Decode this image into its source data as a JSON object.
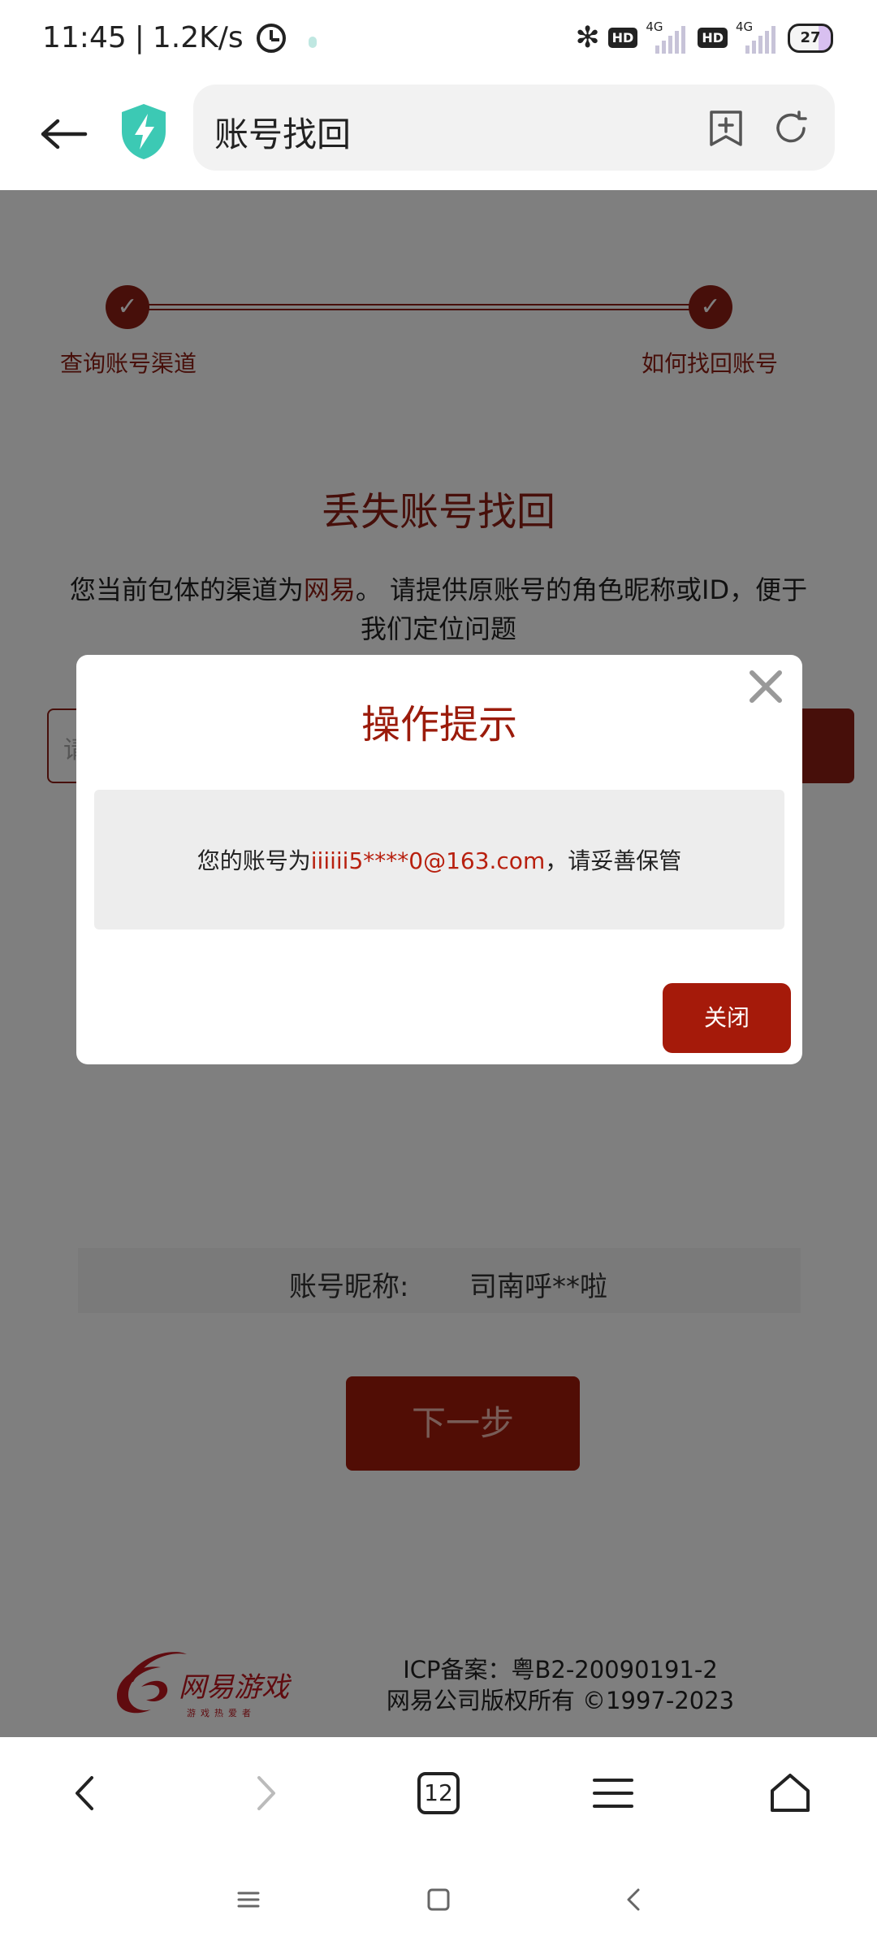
{
  "status_bar": {
    "time": "11:45",
    "separator": "|",
    "speed": "1.2K/s",
    "hd1": "HD",
    "net1": "4G",
    "hd2": "HD",
    "net2": "4G",
    "battery": "27"
  },
  "address_bar": {
    "title": "账号找回"
  },
  "steps": [
    {
      "label": "查询账号渠道",
      "icon": "check-icon"
    },
    {
      "label": "如何找回账号",
      "icon": "check-icon"
    }
  ],
  "main": {
    "title": "丢失账号找回",
    "desc_prefix": "您当前包体的渠道为",
    "desc_brand": "网易",
    "desc_suffix": "。 请提供原账号的角色昵称或ID，便于我们定位问题",
    "input_placeholder": "请",
    "nickname_label": "账号昵称:",
    "nickname_value": "司南呼**啦",
    "next_button": "下一步"
  },
  "footer": {
    "logo_text": "网易游戏",
    "icp": "ICP备案：粤B2-20090191-2",
    "copyright": "网易公司版权所有 ©1997-2023"
  },
  "modal": {
    "title": "操作提示",
    "msg_prefix": "您的账号为",
    "msg_account": "iiiiii5****0@163.com",
    "msg_suffix": "，请妥善保管",
    "close_button": "关闭"
  },
  "toolbar": {
    "tab_count": "12"
  },
  "colors": {
    "brand_red": "#8f1f14",
    "button_red": "#a51a0a"
  }
}
